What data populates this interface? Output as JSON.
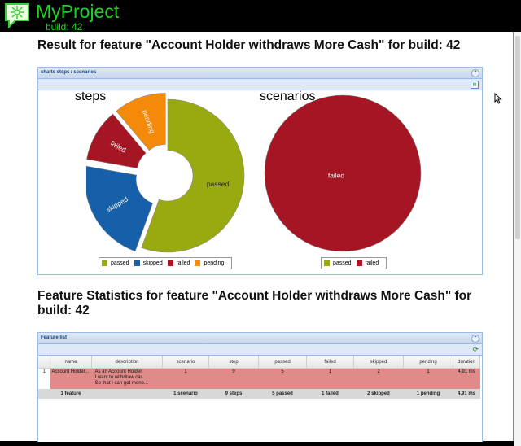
{
  "app": {
    "title": "MyProject",
    "build": "build: 42"
  },
  "heading1": "Result for feature \"Account Holder withdraws More Cash\" for build: 42",
  "charts_panel": {
    "title": "charts steps / scenarios"
  },
  "chart_data": [
    {
      "type": "pie",
      "title": "steps",
      "categories": [
        "passed",
        "skipped",
        "failed",
        "pending"
      ],
      "values": [
        5,
        2,
        1,
        1
      ],
      "colors": [
        "#99aa11",
        "#1560a8",
        "#a51523",
        "#f58a0a"
      ],
      "donut": true
    },
    {
      "type": "pie",
      "title": "scenarios",
      "categories": [
        "passed",
        "failed"
      ],
      "values": [
        0,
        1
      ],
      "colors": [
        "#99aa11",
        "#a51523"
      ]
    }
  ],
  "heading2": "Feature Statistics for feature \"Account Holder withdraws More Cash\" for build: 42",
  "feature_panel": {
    "title": "Feature list",
    "columns": [
      "name",
      "description",
      "scenario",
      "step",
      "passed",
      "failed",
      "skipped",
      "pending",
      "duration"
    ],
    "row": {
      "index": "1",
      "name": "Account Holder...",
      "description_lines": [
        "As an Account Holder",
        "I want to withdraw cas...",
        "So that I can get mone..."
      ],
      "scenario": "1",
      "step": "9",
      "passed": "5",
      "failed": "1",
      "skipped": "2",
      "pending": "1",
      "duration": "4.91 ms"
    },
    "summary": {
      "name": "1 feature",
      "scenario": "1 scenario",
      "step": "9 steps",
      "passed": "5 passed",
      "failed": "1 failed",
      "skipped": "2 skipped",
      "pending": "1 pending",
      "duration": "4.91 ms"
    }
  }
}
